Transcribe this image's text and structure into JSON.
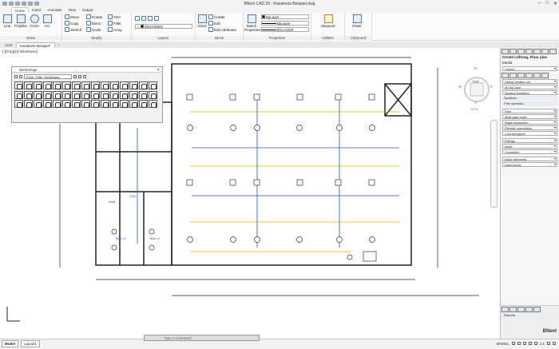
{
  "app": {
    "title": "BNext CAD 20 - Kanalnetz-Beispiel.dwg"
  },
  "menu_tabs": [
    "Home",
    "Insert",
    "Annotate",
    "View",
    "Output"
  ],
  "ribbon": {
    "draw": {
      "label": "Draw",
      "line": "Line",
      "polyline": "Polyline",
      "circle": "Circle",
      "arc": "Arc"
    },
    "modify": {
      "label": "Modify",
      "move": "Move",
      "rotate": "Rotate",
      "trim": "Trim",
      "copy": "Copy",
      "mirror": "Mirror",
      "fillet": "Fillet",
      "stretch": "Stretch",
      "scale": "Scale",
      "array": "Array"
    },
    "layers": {
      "label": "Layers",
      "current": "ZEICHNEN"
    },
    "block": {
      "label": "Block",
      "insert": "Insert",
      "create": "Create",
      "edit": "Edit",
      "edit_attributes": "Edit Attributes"
    },
    "properties": {
      "label": "Properties",
      "match": "Match Properties",
      "color": "ByLayer",
      "linetype": "ByLayer",
      "lineweight": "BYLAYER"
    },
    "utilities": {
      "label": "Utilities",
      "measure": "Measure"
    },
    "clipboard": {
      "label": "Clipboard",
      "paste": "Paste"
    }
  },
  "doc_tabs": [
    "Start",
    "Kanalnetz-Beispiel*"
  ],
  "viewport_label": "[-][Top][2D Wireframe]",
  "palette": {
    "title": "Werkzeuge",
    "dropdown": "Form, Filter, Heizkörper",
    "cells": 45
  },
  "drawing": {
    "label_flur": "Flur",
    "label_buro3": "Büro 3",
    "label_buro4": "Büro 4",
    "label_abst": "Abst."
  },
  "viewcube": {
    "top": "TOP",
    "n": "N",
    "s": "S",
    "w": "W",
    "e": "E",
    "wcs": "WCS"
  },
  "right_panel": {
    "title": "Create Lüftung, Floor plan",
    "media_label": "Media",
    "media_value": "<ohne>",
    "items": [
      "Storey section cut",
      "2D Air Duct",
      "Symbol functions",
      "Symbols...",
      "Free symbols...",
      "Pipe",
      "Multi-pipe route",
      "Rigid connection",
      "Flexible connection",
      "Connect pipes",
      "Fittings",
      "Node",
      "Crossover",
      "Basic elements",
      "Insert block"
    ],
    "bottom": "Reports",
    "brand": "BNext"
  },
  "status": {
    "model_tab": "Model",
    "layout_tab": "Layout1",
    "command_placeholder": "Type a command",
    "mode": "MODEL",
    "scale": "1:1"
  }
}
